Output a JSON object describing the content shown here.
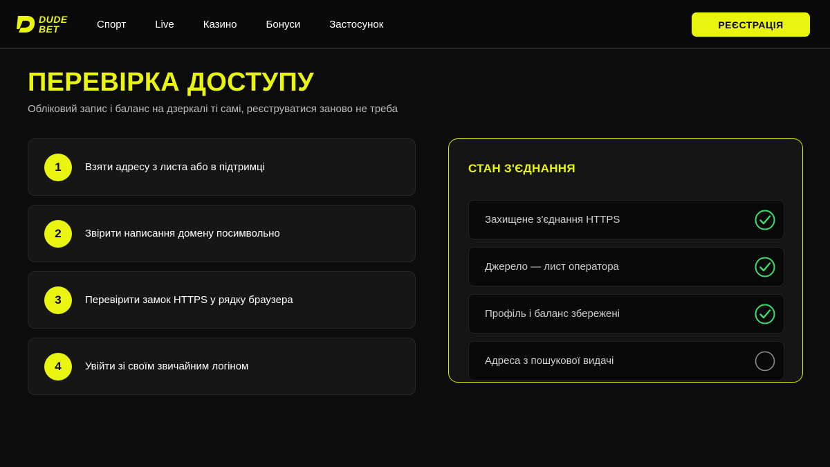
{
  "brand": {
    "logo_line1": "DUDE",
    "logo_line2": "BET",
    "accent_color": "#eaf50f"
  },
  "nav": {
    "items": [
      {
        "label": "Спорт"
      },
      {
        "label": "Live"
      },
      {
        "label": "Казино"
      },
      {
        "label": "Бонуси"
      },
      {
        "label": "Застосунок"
      }
    ],
    "register_label": "РЕЄСТРАЦІЯ"
  },
  "main": {
    "title": "ПЕРЕВІРКА ДОСТУПУ",
    "subtitle": "Обліковий запис і баланс на дзеркалі ті самі, реєструватися заново не треба",
    "steps": [
      {
        "number": "1",
        "text": "Взяти адресу з листа або в підтримці"
      },
      {
        "number": "2",
        "text": "Звірити написання домену посимвольно"
      },
      {
        "number": "3",
        "text": "Перевірити замок HTTPS у рядку браузера"
      },
      {
        "number": "4",
        "text": "Увійти зі своїм звичайним логіном"
      }
    ]
  },
  "status_panel": {
    "title": "СТАН З'ЄДНАННЯ",
    "checked_color": "#3ddc6b",
    "unchecked_color": "#8a8a8a",
    "items": [
      {
        "label": "Захищене з'єднання HTTPS",
        "checked": true,
        "icon": "check-circle-icon"
      },
      {
        "label": "Джерело — лист оператора",
        "checked": true,
        "icon": "check-circle-icon"
      },
      {
        "label": "Профіль і баланс збережені",
        "checked": true,
        "icon": "check-circle-icon"
      },
      {
        "label": "Адреса з пошукової видачі",
        "checked": false,
        "icon": "empty-circle-icon"
      }
    ]
  }
}
